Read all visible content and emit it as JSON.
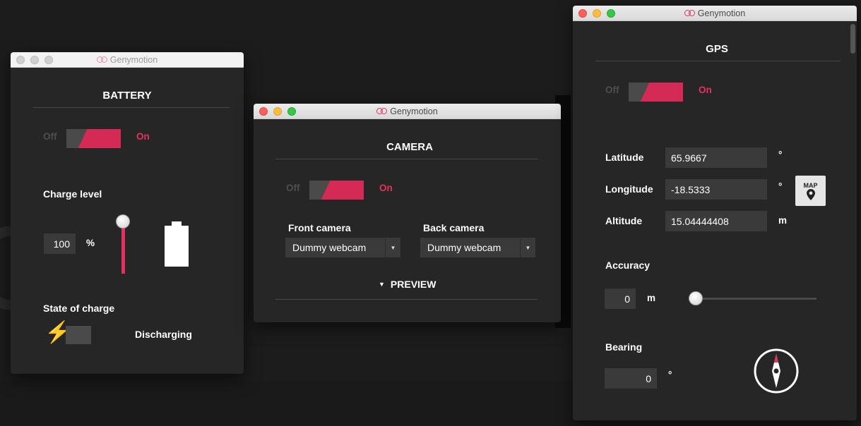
{
  "battery_window": {
    "title": "Genymotion",
    "panel_title": "BATTERY",
    "toggle": {
      "off_label": "Off",
      "on_label": "On",
      "state": "on"
    },
    "charge_level_label": "Charge level",
    "charge_value": "100",
    "charge_unit": "%",
    "charge_level": 1.0,
    "state_of_charge_label": "State of charge",
    "state_of_charge_value": "Discharging"
  },
  "camera_window": {
    "title": "Genymotion",
    "panel_title": "CAMERA",
    "toggle": {
      "off_label": "Off",
      "on_label": "On",
      "state": "on"
    },
    "front_camera_label": "Front camera",
    "front_camera_value": "Dummy webcam",
    "back_camera_label": "Back camera",
    "back_camera_value": "Dummy webcam",
    "preview_label": "PREVIEW"
  },
  "gps_window": {
    "title": "Genymotion",
    "panel_title": "GPS",
    "toggle": {
      "off_label": "Off",
      "on_label": "On",
      "state": "on"
    },
    "latitude_label": "Latitude",
    "latitude_value": "65.9667",
    "latitude_unit": "°",
    "longitude_label": "Longitude",
    "longitude_value": "-18.5333",
    "longitude_unit": "°",
    "map_button_label": "MAP",
    "altitude_label": "Altitude",
    "altitude_value": "15.04444408",
    "altitude_unit": "m",
    "accuracy_label": "Accuracy",
    "accuracy_value": "0",
    "accuracy_unit": "m",
    "accuracy_slider_level": 0.0,
    "bearing_label": "Bearing",
    "bearing_value": "0",
    "bearing_unit": "°"
  },
  "colors": {
    "accent": "#e5315d",
    "window_bg": "#262626",
    "field_bg": "#3a3a3a",
    "desktop_bg": "#1c1c1c"
  },
  "icons": [
    "genymotion-logo-icon",
    "battery-icon",
    "lightning-bolt-icon",
    "dropdown-arrow-icon",
    "triangle-down-icon",
    "map-pin-icon",
    "compass-icon"
  ]
}
